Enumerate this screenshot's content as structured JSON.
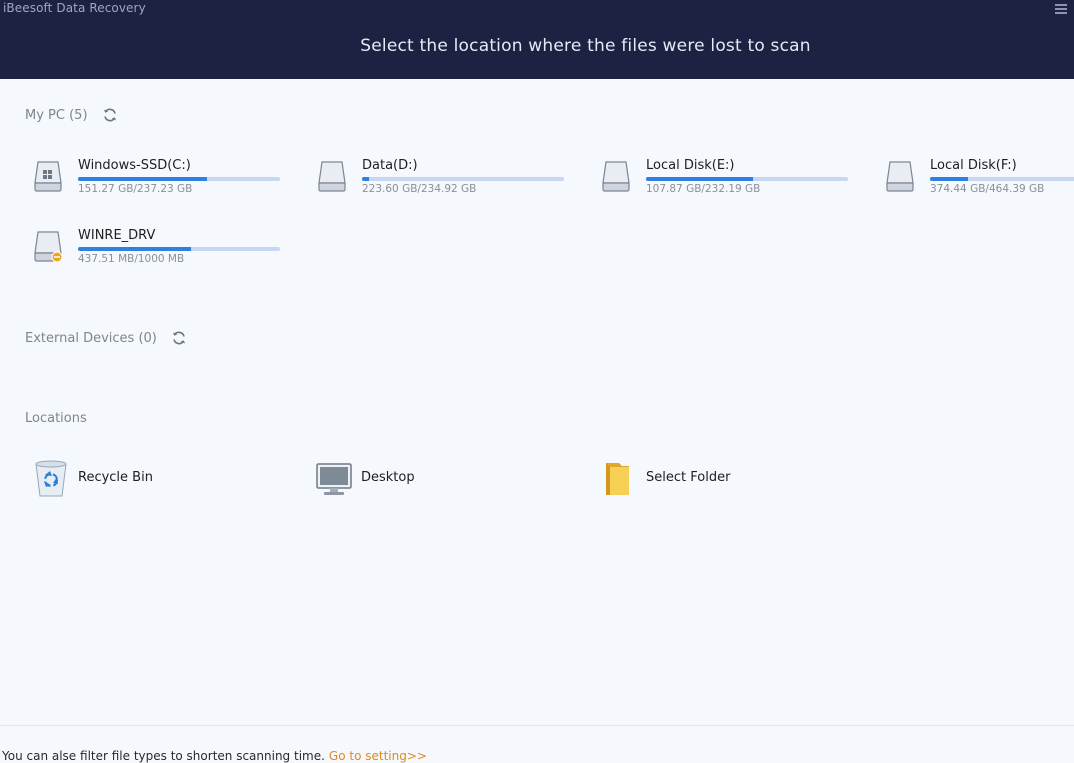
{
  "app": {
    "title": "iBeesoft Data Recovery",
    "header_title": "Select the location where the files were lost to scan"
  },
  "colors": {
    "header_bg": "#1c2242",
    "usage_fill": "#2f7fe4",
    "usage_track": "#c5d7f3",
    "link": "#e08a1d"
  },
  "sections": {
    "my_pc": {
      "label": "My PC",
      "count": "(5)"
    },
    "external": {
      "label": "External Devices",
      "count": "(0)"
    },
    "locations": {
      "label": "Locations"
    }
  },
  "drives": [
    {
      "name": "Windows-SSD(C:)",
      "size": "151.27 GB/237.23 GB",
      "used_fraction": 0.64,
      "icon": "windows-drive-icon"
    },
    {
      "name": "Data(D:)",
      "size": "223.60 GB/234.92 GB",
      "used_fraction": 0.035,
      "icon": "hard-drive-icon"
    },
    {
      "name": "Local Disk(E:)",
      "size": "107.87 GB/232.19 GB",
      "used_fraction": 0.53,
      "icon": "hard-drive-icon"
    },
    {
      "name": "Local Disk(F:)",
      "size": "374.44 GB/464.39 GB",
      "used_fraction": 0.19,
      "icon": "hard-drive-icon"
    },
    {
      "name": "WINRE_DRV",
      "size": "437.51 MB/1000 MB",
      "used_fraction": 0.56,
      "icon": "removable-drive-icon"
    }
  ],
  "locations": [
    {
      "name": "Recycle Bin",
      "icon": "recycle-bin-icon"
    },
    {
      "name": "Desktop",
      "icon": "desktop-monitor-icon"
    },
    {
      "name": "Select Folder",
      "icon": "folder-icon"
    }
  ],
  "footer": {
    "text": "You can alse filter file types to shorten scanning time.",
    "link": "Go to setting>>"
  }
}
